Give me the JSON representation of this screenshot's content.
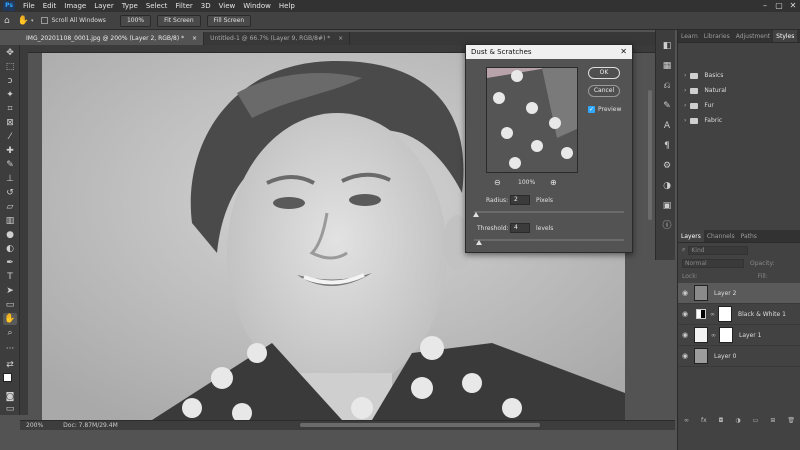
{
  "menubar": {
    "items": [
      "File",
      "Edit",
      "Image",
      "Layer",
      "Type",
      "Select",
      "Filter",
      "3D",
      "View",
      "Window",
      "Help"
    ],
    "window_controls": [
      "minimize",
      "maximize",
      "close"
    ]
  },
  "options_bar": {
    "scroll_all_windows_label": "Scroll All Windows",
    "zoom_100_label": "100%",
    "fit_screen_label": "Fit Screen",
    "fill_screen_label": "Fill Screen"
  },
  "doc_tabs": [
    {
      "label": "IMG_20201108_0001.jpg @ 200% (Layer 2, RGB/8) *",
      "active": true
    },
    {
      "label": "Untitled-1 @ 66.7% (Layer 9, RGB/8#) *",
      "active": false
    }
  ],
  "status_bar": {
    "zoom": "200%",
    "doc_info": "Doc: 7.87M/29.4M"
  },
  "dialog": {
    "title": "Dust & Scratches",
    "ok_label": "OK",
    "cancel_label": "Cancel",
    "preview_label": "Preview",
    "preview_checked": true,
    "zoom_level": "100%",
    "radius_label": "Radius:",
    "radius_value": "2",
    "radius_unit": "Pixels",
    "threshold_label": "Threshold:",
    "threshold_value": "4",
    "threshold_unit": "levels"
  },
  "styles_panel": {
    "tabs": [
      "Learn",
      "Libraries",
      "Adjustment",
      "Styles"
    ],
    "active_tab": "Styles",
    "folders": [
      "Basics",
      "Natural",
      "Fur",
      "Fabric"
    ]
  },
  "layers_panel": {
    "tabs": [
      "Layers",
      "Channels",
      "Paths"
    ],
    "active_tab": "Layers",
    "search_placeholder": "Kind",
    "blend_mode": "Normal",
    "opacity_label": "Opacity:",
    "lock_label": "Lock:",
    "fill_label": "Fill:",
    "layers": [
      {
        "name": "Layer 2",
        "selected": true
      },
      {
        "name": "Black & White 1",
        "selected": false
      },
      {
        "name": "Layer 1",
        "selected": false
      },
      {
        "name": "Layer 0",
        "selected": false
      }
    ]
  },
  "colors": {
    "accent": "#31a8ff",
    "canvas_bg": "#535353",
    "panel_bg": "#424242"
  }
}
